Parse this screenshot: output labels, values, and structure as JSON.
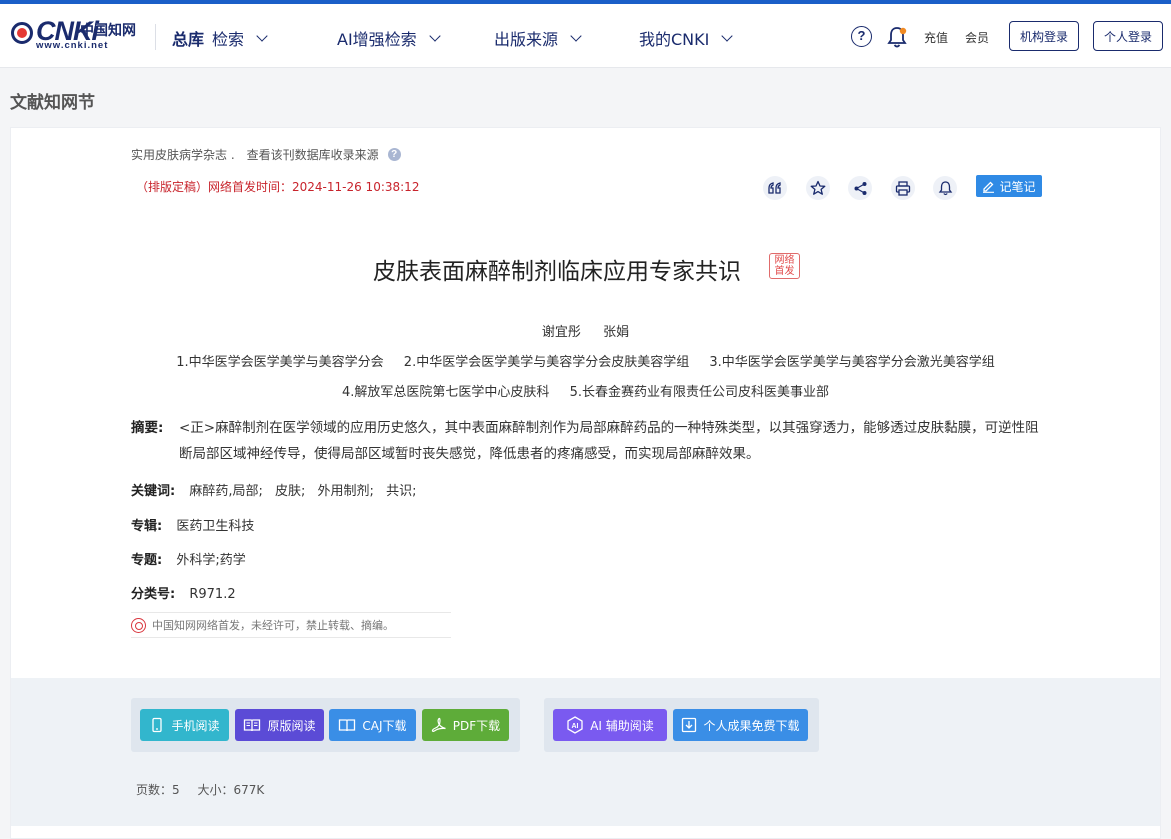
{
  "header": {
    "logo_text": "CNKi",
    "logo_cn": "中国知网",
    "logo_url": "www.cnki.net",
    "nav": [
      {
        "bold": "总库",
        "label": "检索"
      },
      {
        "label": "AI增强检索"
      },
      {
        "label": "出版来源"
      },
      {
        "label": "我的CNKI"
      }
    ],
    "help": "?",
    "recharge": "充值",
    "member": "会员",
    "org_login": "机构登录",
    "personal_login": "个人登录"
  },
  "page_title": "文献知网节",
  "article": {
    "journal": "实用皮肤病学杂志 .",
    "source_link": "查看该刊数据库收录来源",
    "pub_time": "（排版定稿）网络首发时间：2024-11-26 10:38:12",
    "note_button": "记笔记",
    "title": "皮肤表面麻醉制剂临床应用专家共识",
    "net_badge_line1": "网络",
    "net_badge_line2": "首发",
    "authors": [
      "谢宜彤",
      "张娟"
    ],
    "orgs_line1": [
      "1.中华医学会医学美学与美容学分会",
      "2.中华医学会医学美学与美容学分会皮肤美容学组",
      "3.中华医学会医学美学与美容学分会激光美容学组"
    ],
    "orgs_line2": [
      "4.解放军总医院第七医学中心皮肤科",
      "5.长春金赛药业有限责任公司皮科医美事业部"
    ],
    "abstract_label": "摘要:",
    "abstract": "<正>麻醉制剂在医学领域的应用历史悠久，其中表面麻醉制剂作为局部麻醉药品的一种特殊类型，以其强穿透力，能够透过皮肤黏膜，可逆性阻断局部区域神经传导，使得局部区域暂时丧失感觉，降低患者的疼痛感受，而实现局部麻醉效果。",
    "keywords_label": "关键词:",
    "keywords": [
      "麻醉药,局部;",
      "皮肤;",
      "外用制剂;",
      "共识;"
    ],
    "series_label": "专辑:",
    "series": "医药卫生科技",
    "topic_label": "专题:",
    "topic": "外科学;药学",
    "class_label": "分类号:",
    "class_no": "R971.2",
    "copyright": "中国知网网络首发，未经许可，禁止转载、摘编。"
  },
  "downloads": {
    "mobile": "手机阅读",
    "original": "原版阅读",
    "caj": "CAJ下载",
    "pdf": "PDF下载",
    "ai": "AI 辅助阅读",
    "free": "个人成果免费下载",
    "pages_label": "页数：",
    "pages": "5",
    "size_label": "大小：",
    "size": "677K"
  },
  "colors": {
    "brand": "#1a2b6d",
    "accent_blue": "#2f8ae5",
    "mobile": "#32b6cd",
    "original": "#5b4bd6",
    "caj": "#3a8ee6",
    "pdf": "#5eac39",
    "ai": "#7a5af0",
    "free": "#3a8ee6",
    "red": "#c8242c"
  },
  "icons": [
    "help-icon",
    "bell-icon",
    "quote-icon",
    "star-icon",
    "share-icon",
    "print-icon",
    "alert-icon",
    "edit-icon",
    "phone-icon",
    "book-icon",
    "download-icon",
    "pdf-icon",
    "ai-icon"
  ]
}
